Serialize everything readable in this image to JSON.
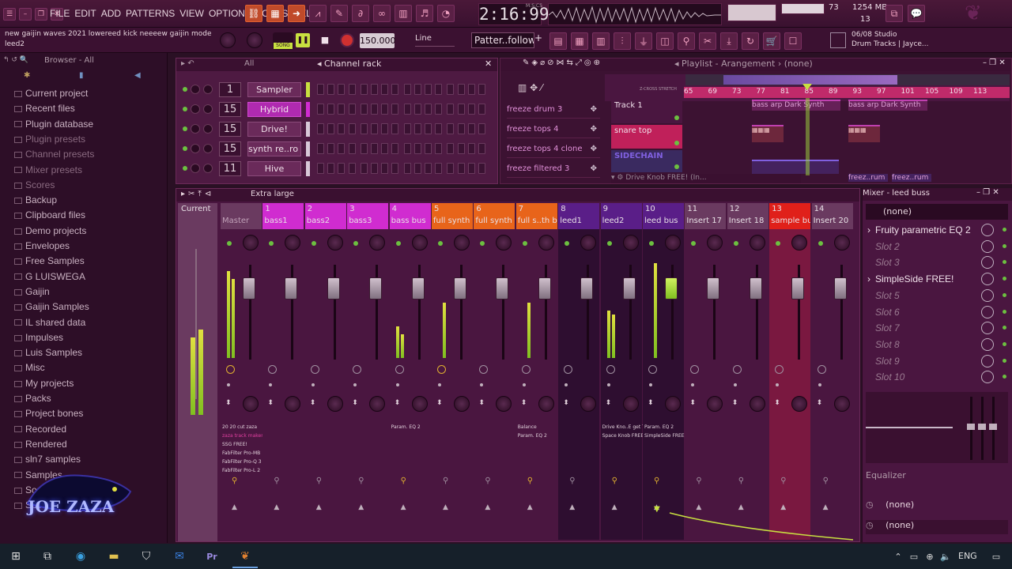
{
  "menu": [
    "FILE",
    "EDIT",
    "ADD",
    "PATTERNS",
    "VIEW",
    "OPTIONS",
    "TOOLS",
    "HELP"
  ],
  "hint": {
    "line1": "new gaijin waves 2021 lowereed kick neeeew gaijin mode",
    "line2": "leed2"
  },
  "transport": {
    "time": "2:16:99",
    "time_label": "M:S:CS",
    "tempo": "150.000",
    "mode": "SONG",
    "snap": "Line",
    "pattern": "Patter..follow"
  },
  "cpu": {
    "value": "73",
    "ram": "1254 MB",
    "voices": "13"
  },
  "news": {
    "date": "06/08",
    "line1": "Studio",
    "line2": "Drum Tracks | Jayce..."
  },
  "browser": {
    "title": "Browser - All",
    "items": [
      "Current project",
      "Recent files",
      "Plugin database",
      "Plugin presets",
      "Channel presets",
      "Mixer presets",
      "Scores",
      "Backup",
      "Clipboard files",
      "Demo projects",
      "Envelopes",
      "Free Samples",
      "G LUISWEGA",
      "Gaijin",
      "Gaijin Samples",
      "IL shared data",
      "Impulses",
      "Luis Samples",
      "Misc",
      "My projects",
      "Packs",
      "Project bones",
      "Recorded",
      "Rendered",
      "sln7 samples",
      "Samples",
      "Soundfonts",
      "Speech"
    ]
  },
  "channel_rack": {
    "title": "Channel rack",
    "filter": "All",
    "channels": [
      {
        "num": "1",
        "name": "Sampler"
      },
      {
        "num": "15",
        "name": "Hybrid"
      },
      {
        "num": "15",
        "name": "Drive!"
      },
      {
        "num": "15",
        "name": "synth re..ro sin7"
      },
      {
        "num": "11",
        "name": "Hive"
      }
    ]
  },
  "playlist": {
    "title": "Playlist - Arangement",
    "pattern": "(none)",
    "patterns": [
      "freeze drum 3",
      "freeze tops 4",
      "freeze tops 4 clone",
      "freeze filtered 3"
    ],
    "tracks": [
      "Track 1",
      "snare top",
      "SIDECHAIN"
    ],
    "bars": [
      "65",
      "69",
      "73",
      "77",
      "81",
      "85",
      "89",
      "93",
      "97",
      "101",
      "105",
      "109",
      "113"
    ],
    "clip1": "bass arp Dark Synth",
    "clip2": "bass arp Dark Synth",
    "clip3": "freez..rum 3",
    "clip4": "freez..rum 3",
    "plugin_hint": "Drive Knob FREE! (In..."
  },
  "mixer": {
    "zoom": "Extra large",
    "current": "Current",
    "strips": [
      {
        "num": "",
        "name": "Master"
      },
      {
        "num": "1",
        "name": "bass1"
      },
      {
        "num": "2",
        "name": "bass2"
      },
      {
        "num": "3",
        "name": "bass3"
      },
      {
        "num": "4",
        "name": "bass bus"
      },
      {
        "num": "5",
        "name": "full synth 1"
      },
      {
        "num": "6",
        "name": "full synth 2"
      },
      {
        "num": "7",
        "name": "full s..th bus"
      },
      {
        "num": "8",
        "name": "leed1"
      },
      {
        "num": "9",
        "name": "leed2"
      },
      {
        "num": "10",
        "name": "leed bus"
      },
      {
        "num": "11",
        "name": "Insert 17"
      },
      {
        "num": "12",
        "name": "Insert 18"
      },
      {
        "num": "13",
        "name": "sample bus"
      },
      {
        "num": "14",
        "name": "Insert 20"
      }
    ],
    "master_fx": [
      "20 20 cut zaza",
      "zaza track maker",
      "SSG FREE!",
      "FabFilter Pro-MB",
      "FabFilter Pro-Q 3",
      "FabFilter Pro-L 2"
    ],
    "fx_bass": "Param. EQ 2",
    "fx_fs": [
      "Balance",
      "Param. EQ 2"
    ],
    "fx_leed1": [
      "Drive Kno..E get THIS!",
      "Space Knob FREE!"
    ],
    "fx_leed2": [
      "Param. EQ 2",
      "SimpleSide FREE!"
    ]
  },
  "mixer_panel": {
    "title": "Mixer - leed buss",
    "preset": "(none)",
    "slots": [
      "Fruity parametric EQ 2",
      "Slot 2",
      "Slot 3",
      "SimpleSide FREE!",
      "Slot 5",
      "Slot 6",
      "Slot 7",
      "Slot 8",
      "Slot 9",
      "Slot 10"
    ],
    "eq_label": "Equalizer",
    "route_in": "(none)",
    "route_out": "(none)"
  },
  "watermark": "JOE ZAZA",
  "taskbar": {
    "lang": "ENG"
  },
  "colors": {
    "accent": "#d02cd0",
    "orange": "#e8641a",
    "red": "#e0201a",
    "purple": "#5a1e88",
    "meter": "#b8e030"
  }
}
